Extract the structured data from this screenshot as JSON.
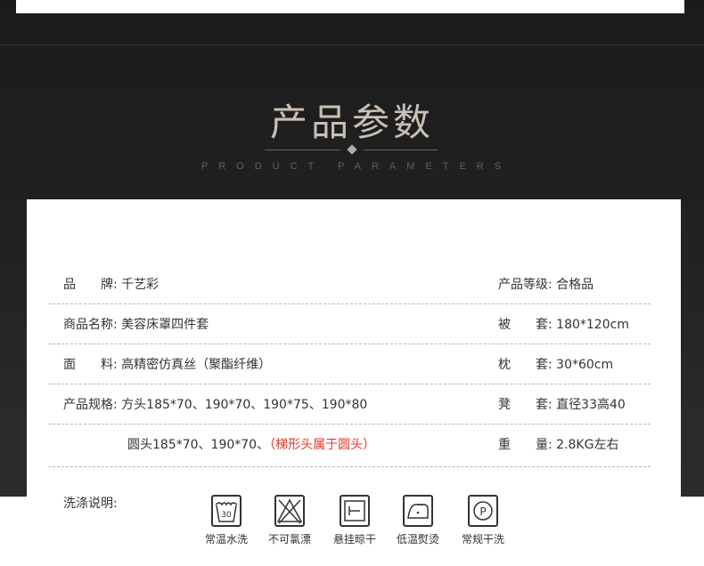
{
  "section": {
    "title": "产品参数",
    "subtitle": "PRODUCT PARAMETERS"
  },
  "rows": [
    {
      "left_label": "品　　牌:",
      "left_value": "千艺彩",
      "right_label": "产品等级:",
      "right_value": "合格品"
    },
    {
      "left_label": "商品名称:",
      "left_value": "美容床罩四件套",
      "right_label": "被　　套:",
      "right_value": "180*120cm"
    },
    {
      "left_label": "面　　料:",
      "left_value": "高精密仿真丝（聚酯纤维）",
      "right_label": "枕　　套:",
      "right_value": " 30*60cm"
    },
    {
      "left_label": "产品规格:",
      "left_value": "方头185*70、190*70、190*75、190*80",
      "right_label": "凳　　套:",
      "right_value": " 直径33高40"
    },
    {
      "left_label": "",
      "left_value": "圆头185*70、190*70、",
      "left_note": "（梯形头属于圆头）",
      "right_label": "重　　量:",
      "right_value": "2.8KG左右"
    }
  ],
  "care": {
    "label": "洗涤说明:",
    "items": [
      {
        "icon": "wash-30-icon",
        "caption": "常温水洗",
        "temp": "30"
      },
      {
        "icon": "no-bleach-icon",
        "caption": "不可氯漂"
      },
      {
        "icon": "hang-dry-icon",
        "caption": "悬挂晾干"
      },
      {
        "icon": "low-iron-icon",
        "caption": "低温熨烫"
      },
      {
        "icon": "dry-clean-icon",
        "caption": "常规干洗",
        "letter": "P"
      }
    ]
  },
  "colors": {
    "background": "#222222",
    "title": "#c9bfb4",
    "note_red": "#e0352b"
  }
}
